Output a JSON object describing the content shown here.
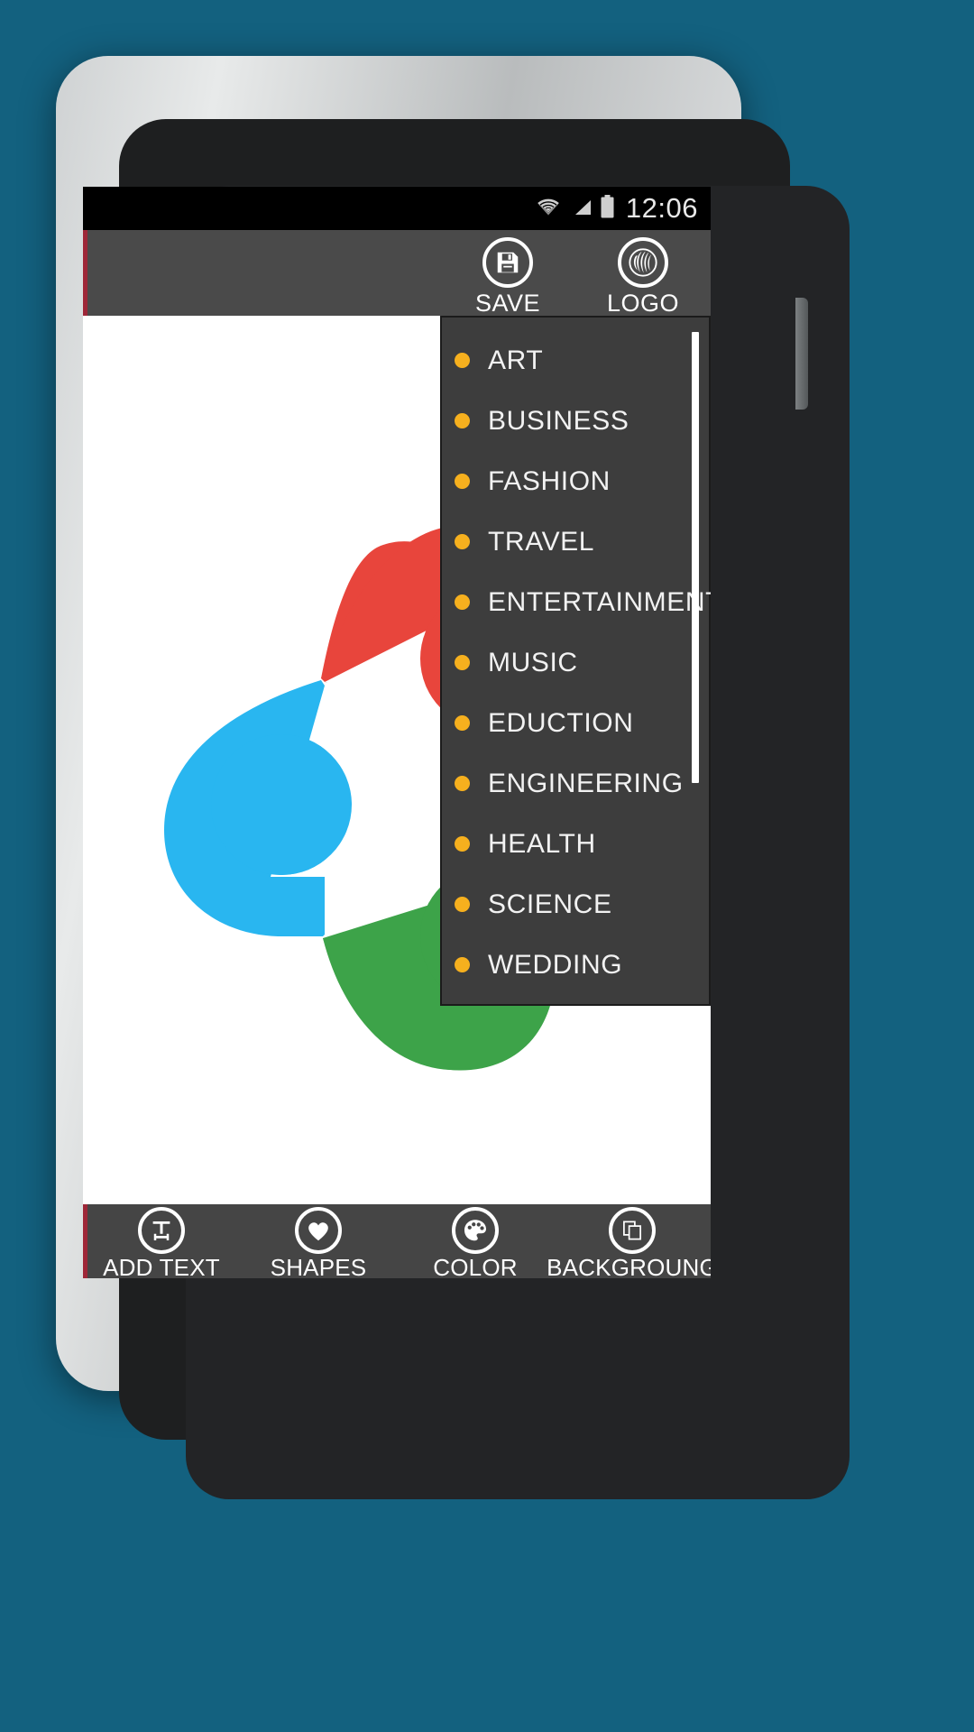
{
  "device": {
    "type": "android-phone",
    "backdrop_color": "#13617f",
    "bezel_color": "#1e1f20"
  },
  "status_bar": {
    "clock": "12:06",
    "icons": [
      "wifi-icon",
      "cellular-signal-icon",
      "battery-icon"
    ],
    "background_color": "#000000"
  },
  "toolbar": {
    "background_color": "#4a4a4a",
    "accent_color": "#9e2738",
    "buttons": [
      {
        "label": "SAVE",
        "icon": "floppy-disk-icon"
      },
      {
        "label": "LOGO",
        "icon": "logo-swirl-icon"
      }
    ]
  },
  "canvas": {
    "background_color": "#ffffff",
    "artwork": {
      "name": "three-person-diamond-logo",
      "colors": {
        "red": "#e8453c",
        "blue": "#29b6f0",
        "green": "#3da349"
      }
    }
  },
  "dropdown": {
    "background_color": "#3d3d3d",
    "bullet_color": "#f6b01e",
    "text_color": "#f2f2f2",
    "scrollbar_color": "#ffffff",
    "items": [
      {
        "label": "ART"
      },
      {
        "label": "BUSINESS"
      },
      {
        "label": "FASHION"
      },
      {
        "label": "TRAVEL"
      },
      {
        "label": "ENTERTAINMENT"
      },
      {
        "label": "MUSIC"
      },
      {
        "label": "EDUCTION"
      },
      {
        "label": "ENGINEERING"
      },
      {
        "label": "HEALTH"
      },
      {
        "label": "SCIENCE"
      },
      {
        "label": "WEDDING"
      }
    ]
  },
  "action_bar": {
    "background_color": "#454545",
    "accent_color": "#9e2738",
    "buttons": [
      {
        "label": "ADD TEXT",
        "icon": "text-tool-icon"
      },
      {
        "label": "SHAPES",
        "icon": "heart-icon"
      },
      {
        "label": "COLOR",
        "icon": "palette-icon"
      },
      {
        "label": "BACKGROUNG",
        "icon": "layers-icon"
      }
    ]
  },
  "nav_bar": {
    "background_color": "#000000",
    "buttons": [
      {
        "name": "back-button",
        "icon": "back-arrow-icon"
      },
      {
        "name": "home-button",
        "icon": "home-icon"
      },
      {
        "name": "recents-button",
        "icon": "recents-icon"
      }
    ]
  }
}
